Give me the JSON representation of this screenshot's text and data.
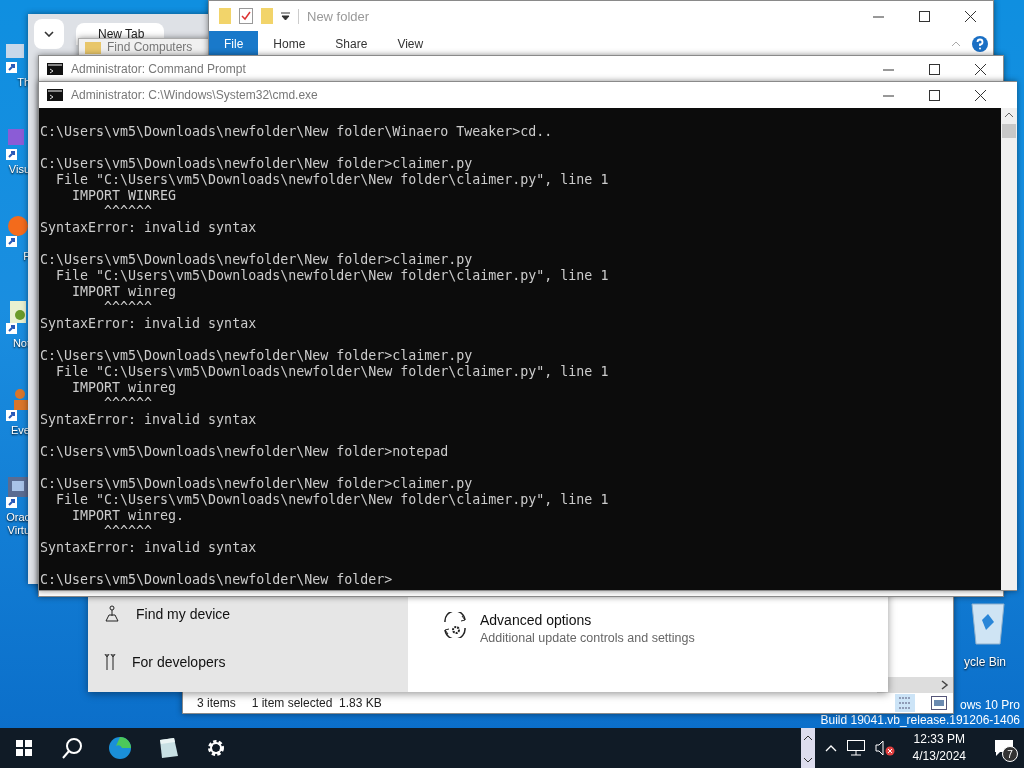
{
  "desktop_icons": [
    {
      "label": "Th",
      "kind": "app"
    },
    {
      "label": "Visu",
      "kind": "code"
    },
    {
      "label": "F",
      "kind": "fox"
    },
    {
      "label": "Not",
      "kind": "notes"
    },
    {
      "label": "Eve",
      "kind": "person"
    },
    {
      "label": "Orac\nVirtu",
      "kind": "box"
    }
  ],
  "recycle_bin": {
    "label": "ycle Bin"
  },
  "desktop_info": [
    "ows 10 Pro",
    "Build 19041.vb_release.191206-1406"
  ],
  "browser": {
    "tab": "New Tab"
  },
  "find_window": {
    "title": "Find Computers"
  },
  "explorer": {
    "title": "New folder",
    "ribbon_tabs": [
      {
        "label": "File",
        "selected": true
      },
      {
        "label": "Home",
        "selected": false
      },
      {
        "label": "Share",
        "selected": false
      },
      {
        "label": "View",
        "selected": false
      }
    ]
  },
  "command_prompt": {
    "title": "Administrator: Command Prompt"
  },
  "cmd": {
    "title": "Administrator: C:\\Windows\\System32\\cmd.exe",
    "blocks": [
      [
        "C:\\Users\\vm5\\Downloads\\newfolder\\New folder\\Winaero Tweaker>cd.."
      ],
      [
        "C:\\Users\\vm5\\Downloads\\newfolder\\New folder>claimer.py",
        "  File \"C:\\Users\\vm5\\Downloads\\newfolder\\New folder\\claimer.py\", line 1",
        "    IMPORT WINREG",
        "        ^^^^^^",
        "SyntaxError: invalid syntax"
      ],
      [
        "C:\\Users\\vm5\\Downloads\\newfolder\\New folder>claimer.py",
        "  File \"C:\\Users\\vm5\\Downloads\\newfolder\\New folder\\claimer.py\", line 1",
        "    IMPORT winreg",
        "        ^^^^^^",
        "SyntaxError: invalid syntax"
      ],
      [
        "C:\\Users\\vm5\\Downloads\\newfolder\\New folder>claimer.py",
        "  File \"C:\\Users\\vm5\\Downloads\\newfolder\\New folder\\claimer.py\", line 1",
        "    IMPORT winreg",
        "        ^^^^^^",
        "SyntaxError: invalid syntax"
      ],
      [
        "C:\\Users\\vm5\\Downloads\\newfolder\\New folder>notepad"
      ],
      [
        "C:\\Users\\vm5\\Downloads\\newfolder\\New folder>claimer.py",
        "  File \"C:\\Users\\vm5\\Downloads\\newfolder\\New folder\\claimer.py\", line 1",
        "    IMPORT winreg.",
        "        ^^^^^^",
        "SyntaxError: invalid syntax"
      ],
      [
        "C:\\Users\\vm5\\Downloads\\newfolder\\New folder>"
      ]
    ]
  },
  "settings": {
    "nav": [
      {
        "label": "Find my device",
        "kind": "find"
      },
      {
        "label": "For developers",
        "kind": "dev"
      }
    ],
    "option": {
      "title": "Advanced options",
      "subtitle": "Additional update controls and settings"
    }
  },
  "explorer_status": {
    "items": "3 items",
    "selection": "1 item selected  1.83 KB"
  },
  "taskbar": {
    "apps": [
      {
        "kind": "start"
      },
      {
        "kind": "search"
      },
      {
        "kind": "edge"
      },
      {
        "kind": "notes"
      },
      {
        "kind": "gear"
      }
    ],
    "volume_muted": true,
    "time": "12:33 PM",
    "date": "4/13/2024",
    "notifications": "7"
  }
}
